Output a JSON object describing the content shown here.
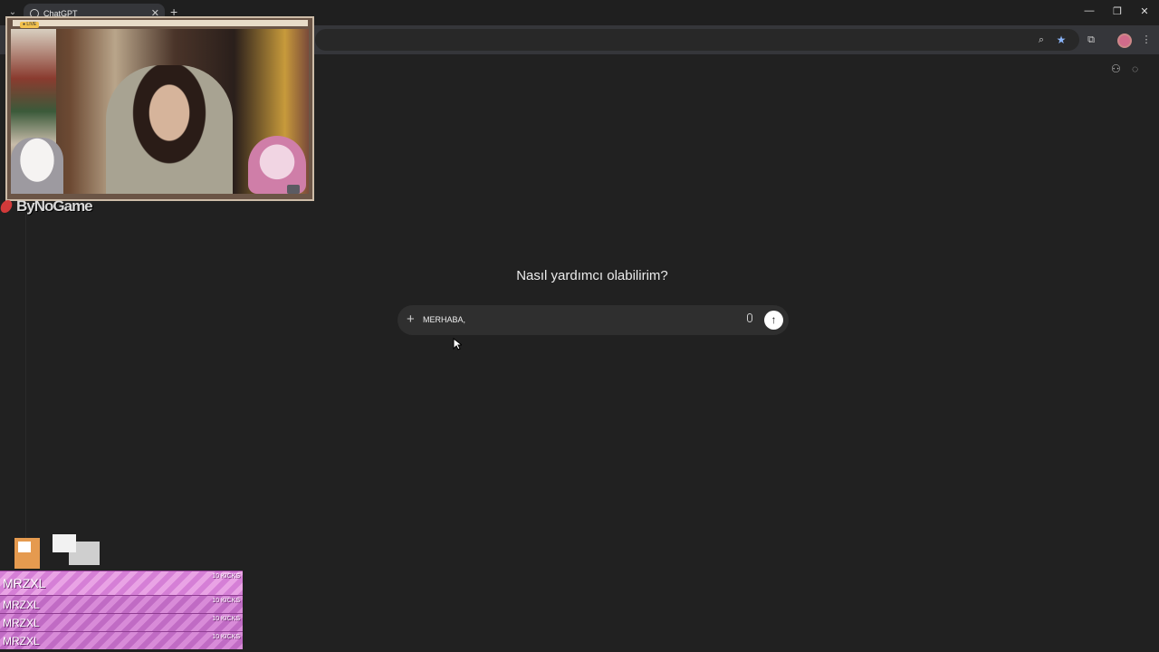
{
  "browser": {
    "tab": {
      "title": "ChatGPT",
      "close_icon": "close-icon"
    },
    "new_tab_symbol": "+",
    "tab_list_symbol": "⌄",
    "window_controls": {
      "minimize": "—",
      "restore": "❐",
      "close": "✕"
    },
    "toolbar_icons": [
      "zoom-icon",
      "bookmark-star-icon",
      "extensions-icon",
      "profile-avatar",
      "menu-dots-icon"
    ]
  },
  "chat": {
    "heading": "Nasıl yardımcı olabilirim?",
    "composer": {
      "value": "MERHABA,",
      "plus_symbol": "+",
      "send_symbol": "↑"
    }
  },
  "stream_overlay": {
    "live_badge": "● LIVE",
    "brand": "ByNoGame",
    "donations": [
      {
        "name": "MRZXL",
        "amount": "10 KICKS"
      },
      {
        "name": "MRZXL",
        "amount": "10 KICKS"
      },
      {
        "name": "MRZXL",
        "amount": "10 KICKS"
      },
      {
        "name": "MRZXL",
        "amount": "10 KICKS"
      }
    ]
  },
  "colors": {
    "background": "#212121",
    "composer_bg": "#2f2f2f",
    "send_button": "#ffffff",
    "donation_pink": "#d88bd8"
  }
}
